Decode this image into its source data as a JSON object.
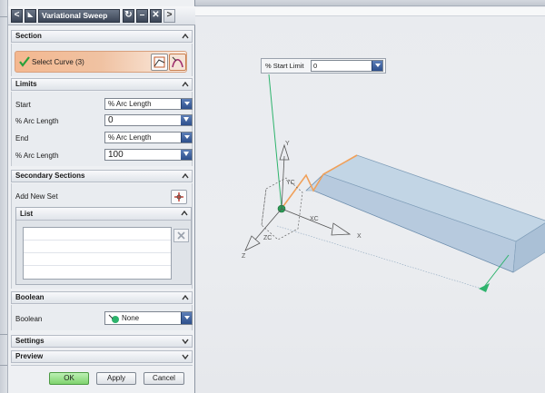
{
  "dialog": {
    "title": "Variational Sweep",
    "title_buttons": {
      "back": "<",
      "reset": "↻",
      "minimize": "–",
      "close": "✕",
      "forward": ">"
    }
  },
  "section": {
    "header": "Section",
    "select_curve_label": "Select Curve (3)"
  },
  "limits": {
    "header": "Limits",
    "start_label": "Start",
    "start_value": "% Arc Length",
    "start_arc_label": "% Arc Length",
    "start_arc_value": "0",
    "end_label": "End",
    "end_value": "% Arc Length",
    "end_arc_label": "% Arc Length",
    "end_arc_value": "100"
  },
  "secondary_sections": {
    "header": "Secondary Sections",
    "add_new_set_label": "Add New Set",
    "list_header": "List"
  },
  "boolean": {
    "header": "Boolean",
    "label": "Boolean",
    "value": "None"
  },
  "collapsed_groups": {
    "settings": "Settings",
    "preview": "Preview"
  },
  "buttons": {
    "ok": "OK",
    "apply": "Apply",
    "cancel": "Cancel"
  },
  "viewport": {
    "start_limit_label": "% Start Limit",
    "start_limit_value": "0",
    "axis_labels": {
      "y": "Y",
      "x": "X",
      "z": "Z",
      "yc": "YC",
      "xc": "XC",
      "zc": "ZC"
    }
  },
  "colors": {
    "accent_orange": "#f0a060",
    "ok_green": "#7fd36e",
    "sheet_fill": "#c6d7e6",
    "curve_orange": "#f0a05a",
    "vector_green": "#2db36c"
  }
}
